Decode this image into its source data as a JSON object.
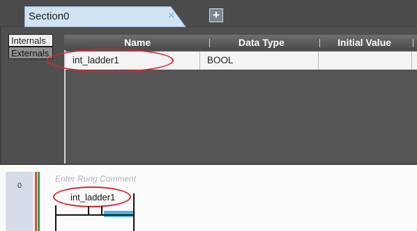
{
  "tab": {
    "label": "Section0",
    "close_glyph": "×",
    "add_glyph": "+"
  },
  "side_tabs": {
    "internals": "Internals",
    "externals": "Externals"
  },
  "grid": {
    "columns": [
      "Name",
      "Data Type",
      "Initial Value"
    ],
    "rows": [
      {
        "name": "int_ladder1",
        "data_type": "BOOL",
        "initial_value": ""
      }
    ]
  },
  "ladder": {
    "rung_number": "0",
    "comment_placeholder": "Enter Rung Comment",
    "contact_variable": "int_ladder1"
  },
  "colors": {
    "highlight": "#d9232e",
    "selected_cell": "#4ab4ea",
    "left_rail_red": "#e0433a",
    "left_rail_green": "#21a34a"
  }
}
